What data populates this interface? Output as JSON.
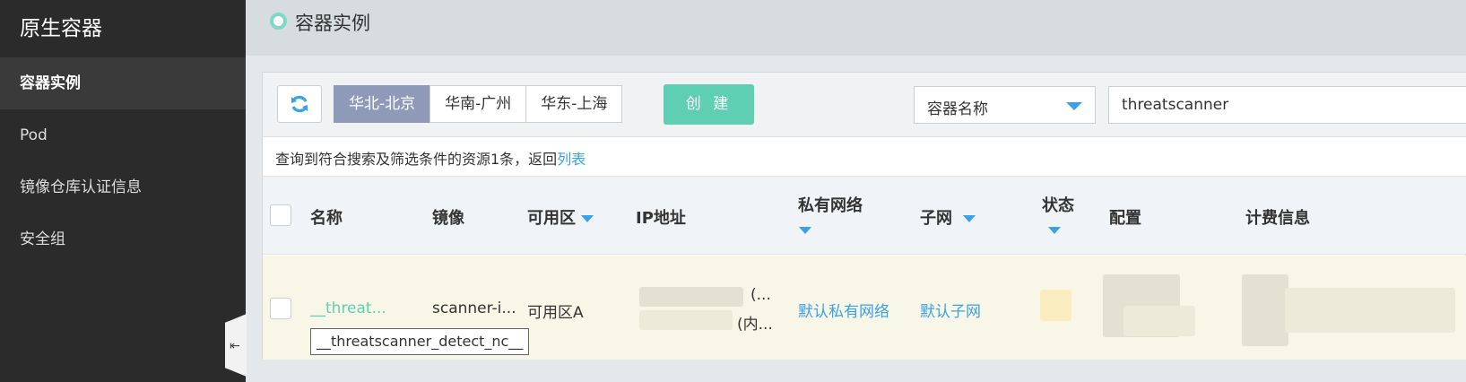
{
  "sidebar": {
    "brand": "原生容器",
    "items": [
      {
        "label": "容器实例",
        "active": true
      },
      {
        "label": "Pod"
      },
      {
        "label": "镜像仓库认证信息"
      },
      {
        "label": "安全组"
      }
    ],
    "collapse_icon": "⇤"
  },
  "header": {
    "title": "容器实例"
  },
  "toolbar": {
    "regions": [
      "华北-北京",
      "华南-广州",
      "华东-上海"
    ],
    "selected_region": "华北-北京",
    "create_label": "创 建",
    "filter_field": "容器名称",
    "search_value": "threatscanner"
  },
  "result": {
    "text": "查询到符合搜索及筛选条件的资源1条，返回",
    "link": "列表"
  },
  "table": {
    "columns": [
      "名称",
      "镜像",
      "可用区",
      "IP地址",
      "私有网络",
      "子网",
      "状态",
      "配置",
      "计费信息"
    ],
    "rows": [
      {
        "name": "__threat...",
        "name_full": "__threatscanner_detect_nc__",
        "image": "scanner-i...",
        "zone": "可用区A",
        "ip_public_suffix": "(...",
        "ip_internal_suffix": "(内...",
        "vpc": "默认私有网络",
        "subnet": "默认子网"
      }
    ]
  },
  "colors": {
    "accent": "#5fcfb4",
    "link": "#3aa0e8",
    "region_selected": "#8f9ab9",
    "sidebar_bg": "#2b2b2b"
  }
}
